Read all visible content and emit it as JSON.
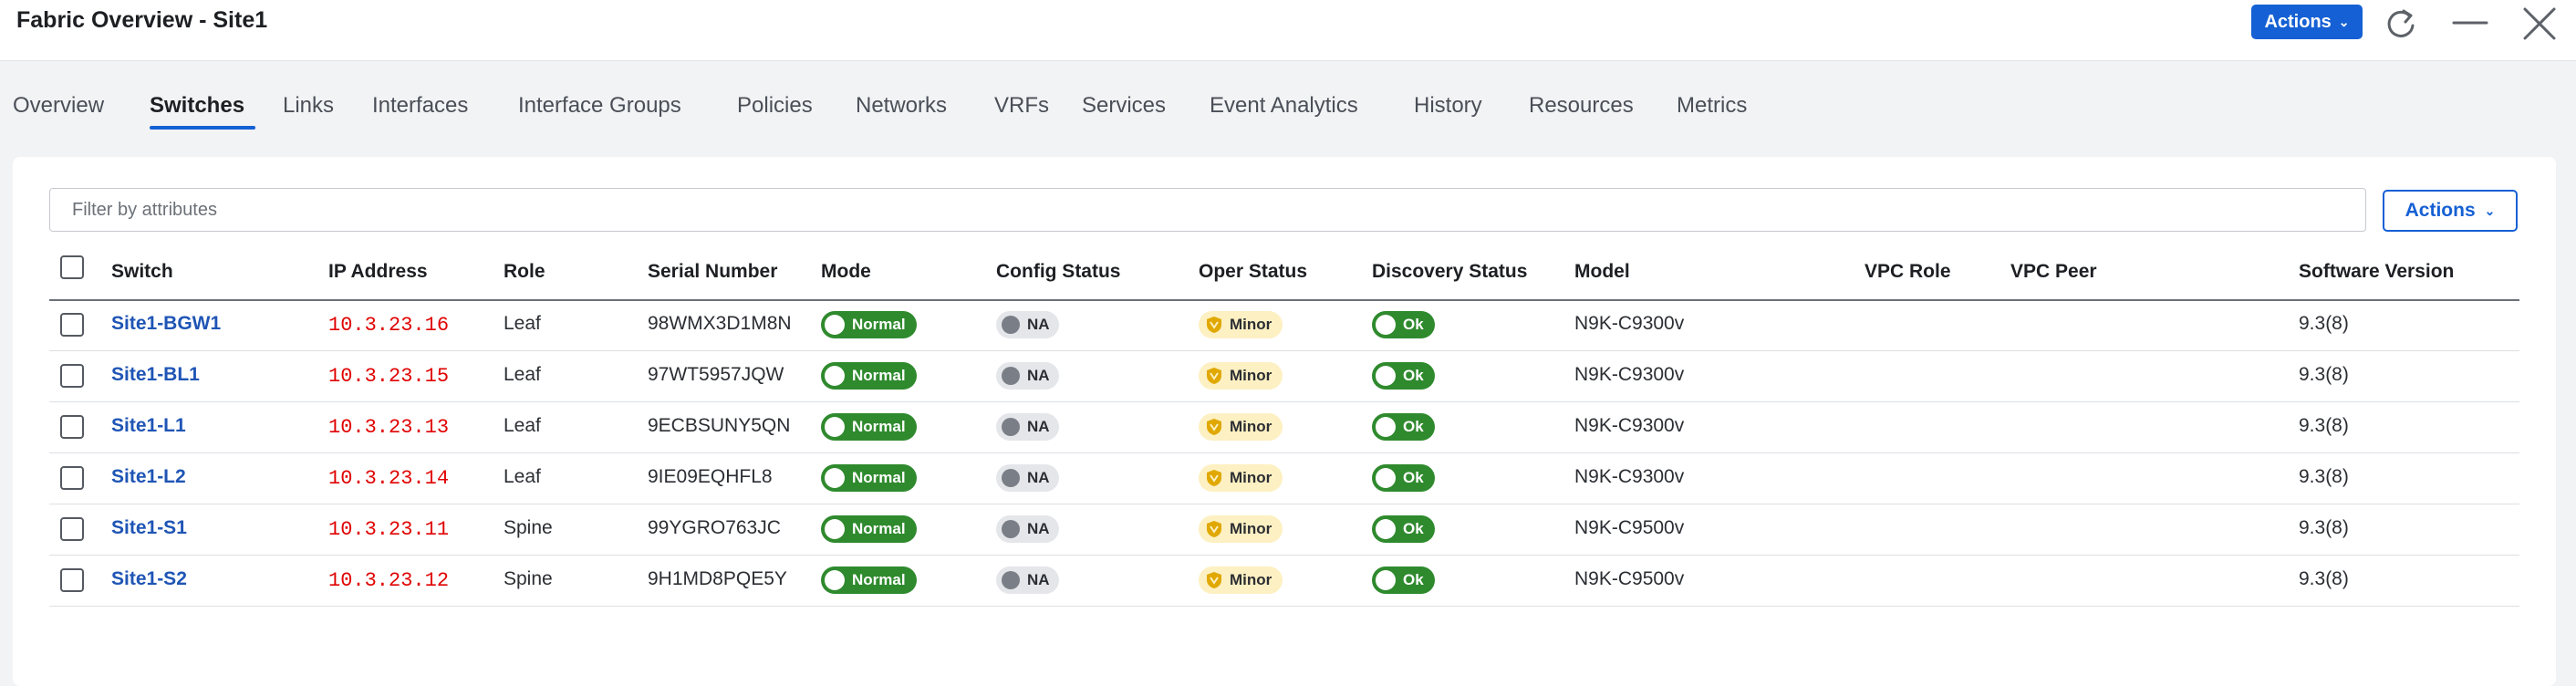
{
  "window": {
    "title": "Fabric Overview - Site1",
    "actions_label": "Actions"
  },
  "tabs": [
    {
      "label": "Overview"
    },
    {
      "label": "Switches",
      "active": true
    },
    {
      "label": "Links"
    },
    {
      "label": "Interfaces"
    },
    {
      "label": "Interface Groups"
    },
    {
      "label": "Policies"
    },
    {
      "label": "Networks"
    },
    {
      "label": "VRFs"
    },
    {
      "label": "Services"
    },
    {
      "label": "Event Analytics"
    },
    {
      "label": "History"
    },
    {
      "label": "Resources"
    },
    {
      "label": "Metrics"
    }
  ],
  "toolbar": {
    "filter_placeholder": "Filter by attributes",
    "actions_label": "Actions"
  },
  "table": {
    "columns": [
      "Switch",
      "IP Address",
      "Role",
      "Serial Number",
      "Mode",
      "Config Status",
      "Oper Status",
      "Discovery Status",
      "Model",
      "VPC Role",
      "VPC Peer",
      "Software Version"
    ],
    "rows": [
      {
        "switch": "Site1-BGW1",
        "ip": "10.3.23.16",
        "role": "Leaf",
        "serial": "98WMX3D1M8N",
        "mode": "Normal",
        "config": "NA",
        "oper": "Minor",
        "discovery": "Ok",
        "model": "N9K-C9300v",
        "vpc_role": "",
        "vpc_peer": "",
        "version": "9.3(8)"
      },
      {
        "switch": "Site1-BL1",
        "ip": "10.3.23.15",
        "role": "Leaf",
        "serial": "97WT5957JQW",
        "mode": "Normal",
        "config": "NA",
        "oper": "Minor",
        "discovery": "Ok",
        "model": "N9K-C9300v",
        "vpc_role": "",
        "vpc_peer": "",
        "version": "9.3(8)"
      },
      {
        "switch": "Site1-L1",
        "ip": "10.3.23.13",
        "role": "Leaf",
        "serial": "9ECBSUNY5QN",
        "mode": "Normal",
        "config": "NA",
        "oper": "Minor",
        "discovery": "Ok",
        "model": "N9K-C9300v",
        "vpc_role": "",
        "vpc_peer": "",
        "version": "9.3(8)"
      },
      {
        "switch": "Site1-L2",
        "ip": "10.3.23.14",
        "role": "Leaf",
        "serial": "9IE09EQHFL8",
        "mode": "Normal",
        "config": "NA",
        "oper": "Minor",
        "discovery": "Ok",
        "model": "N9K-C9300v",
        "vpc_role": "",
        "vpc_peer": "",
        "version": "9.3(8)"
      },
      {
        "switch": "Site1-S1",
        "ip": "10.3.23.11",
        "role": "Spine",
        "serial": "99YGRO763JC",
        "mode": "Normal",
        "config": "NA",
        "oper": "Minor",
        "discovery": "Ok",
        "model": "N9K-C9500v",
        "vpc_role": "",
        "vpc_peer": "",
        "version": "9.3(8)"
      },
      {
        "switch": "Site1-S2",
        "ip": "10.3.23.12",
        "role": "Spine",
        "serial": "9H1MD8PQE5Y",
        "mode": "Normal",
        "config": "NA",
        "oper": "Minor",
        "discovery": "Ok",
        "model": "N9K-C9500v",
        "vpc_role": "",
        "vpc_peer": "",
        "version": "9.3(8)"
      }
    ]
  },
  "icons": {
    "refresh": "refresh-icon",
    "minimize": "minimize-icon",
    "close": "close-icon",
    "dropdown": "chevron-down-icon",
    "warning": "shield-warning-icon"
  },
  "colors": {
    "accent": "#1560d4",
    "link": "#1f55b5",
    "ip_text": "#e00000",
    "normal_badge": "#2f8a2d",
    "na_badge": "#e4e6ea",
    "minor_badge": "#fdf0c2",
    "minor_icon": "#e0a800"
  }
}
